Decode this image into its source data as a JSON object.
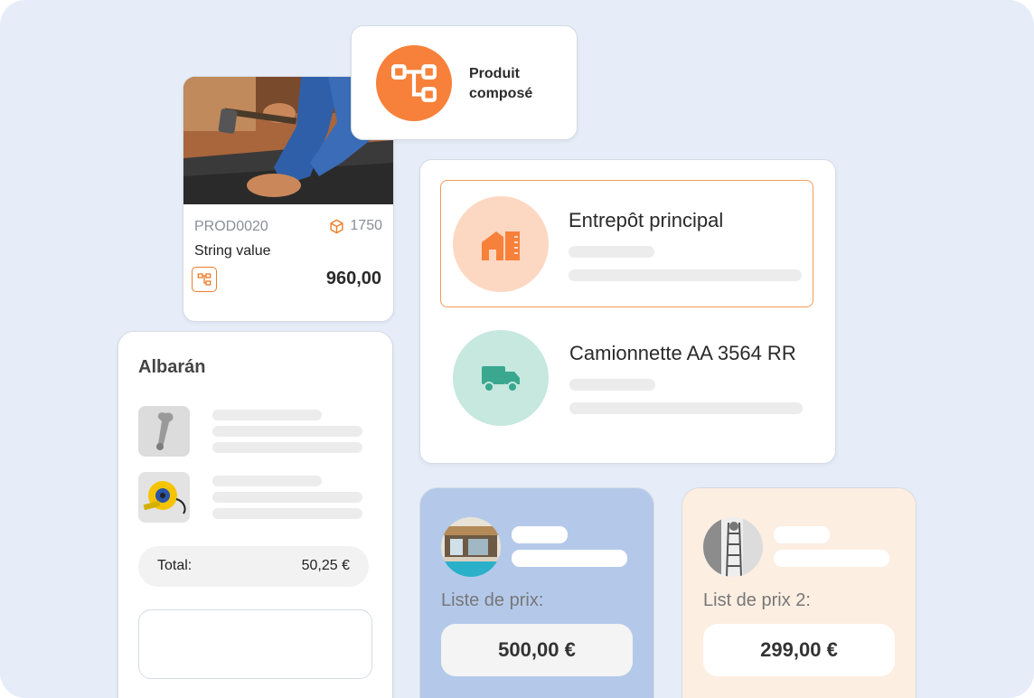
{
  "composite_tag": {
    "label": "Produit composé",
    "icon": "hierarchy-icon"
  },
  "product": {
    "sku": "PROD0020",
    "stock": "1750",
    "name": "String value",
    "price": "960,00",
    "stock_icon": "box-icon"
  },
  "locations": [
    {
      "name": "Entrepôt principal",
      "icon": "warehouse-icon",
      "selected": true
    },
    {
      "name": "Camionnette AA 3564 RR",
      "icon": "truck-icon",
      "selected": false
    }
  ],
  "delivery_note": {
    "title": "Albarán",
    "items": [
      {
        "icon": "wrench-icon"
      },
      {
        "icon": "tape-measure-icon"
      }
    ],
    "total_label": "Total:",
    "total_value": "50,25 €"
  },
  "price_lists": [
    {
      "label": "Liste de prix:",
      "amount": "500,00 €",
      "image": "pool-house-photo"
    },
    {
      "label": "List de prix 2:",
      "amount": "299,00 €",
      "image": "ladder-interior-photo"
    }
  ],
  "colors": {
    "accent_orange": "#f7813a",
    "teal": "#3aa88f",
    "background": "#e6edf8",
    "price_blue": "#b4c9ea",
    "price_peach": "#fdeee2"
  }
}
